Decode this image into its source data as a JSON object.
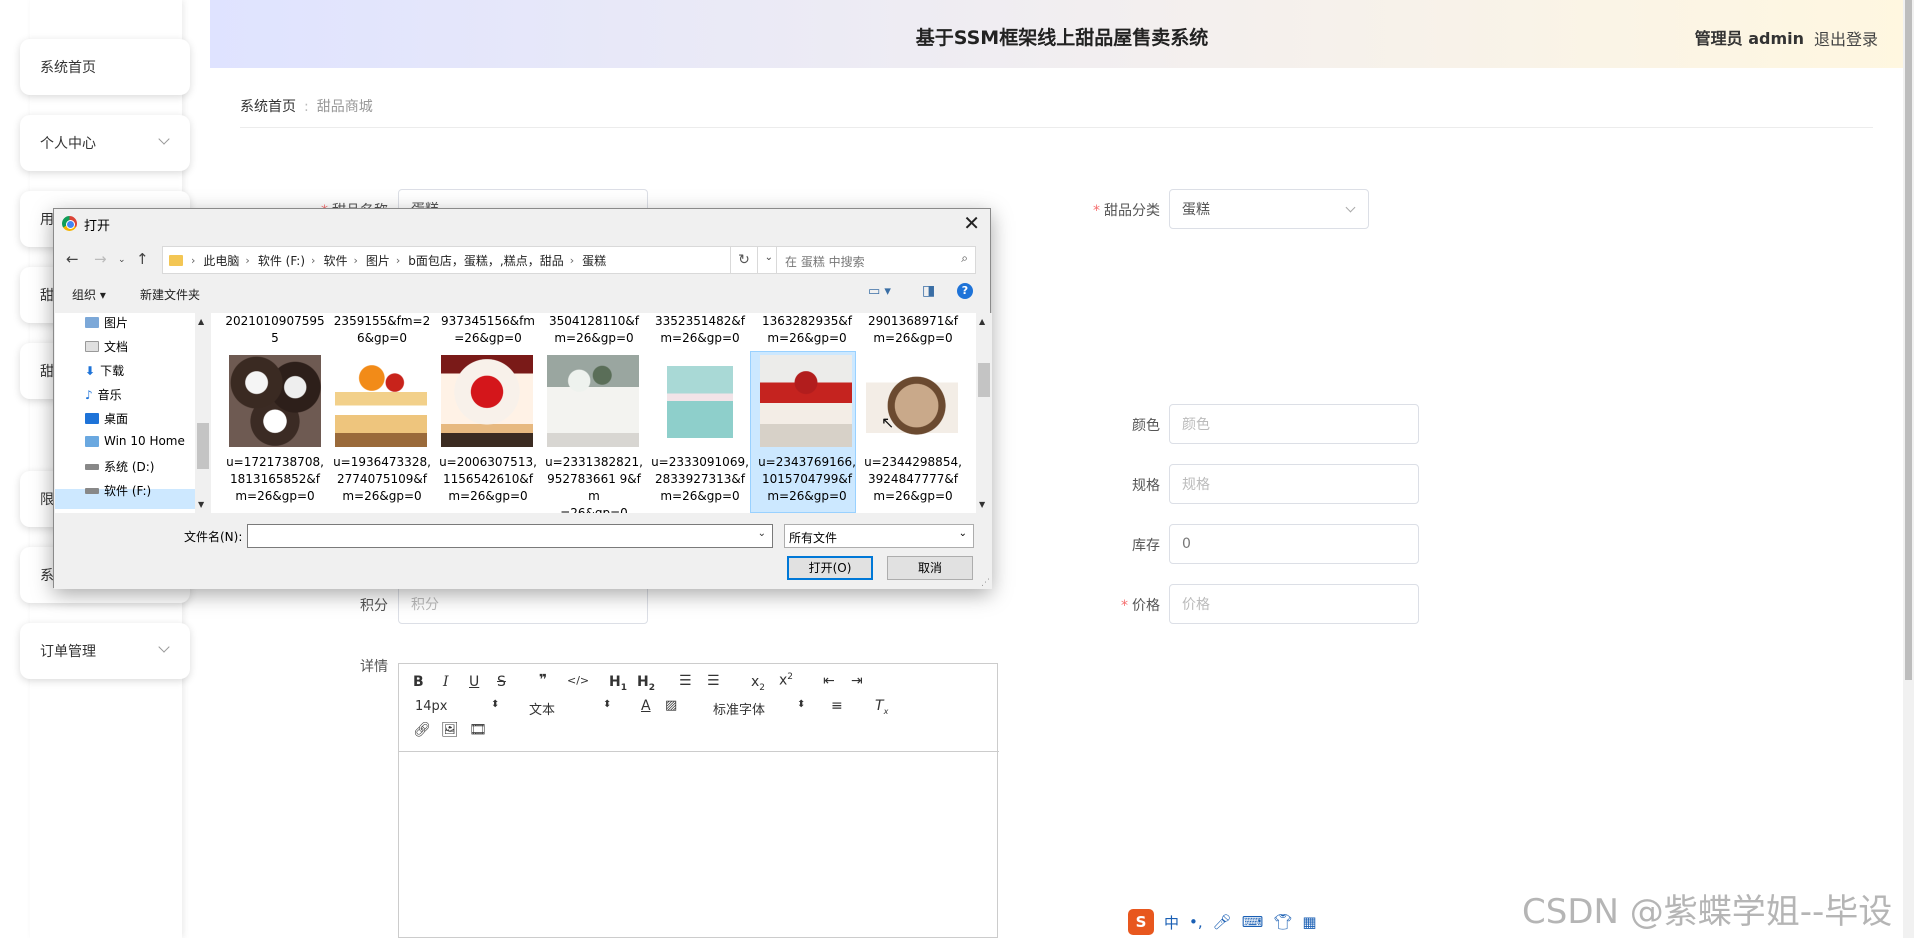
{
  "sidebar": {
    "items": [
      {
        "label": "系统首页",
        "expandable": false
      },
      {
        "label": "个人中心",
        "expandable": true
      },
      {
        "label": "用",
        "expandable": false
      },
      {
        "label": "甜",
        "expandable": false
      },
      {
        "label": "甜",
        "expandable": false
      },
      {
        "label": "限",
        "expandable": false
      },
      {
        "label": "系",
        "expandable": false
      },
      {
        "label": "订单管理",
        "expandable": true
      }
    ]
  },
  "header": {
    "title": "基于SSM框架线上甜品屋售卖系统",
    "user": "管理员 admin",
    "logout": "退出登录"
  },
  "breadcrumb": {
    "home": "系统首页",
    "current": "甜品商城"
  },
  "form": {
    "name_label": "甜品名称",
    "name_value": "蛋糕",
    "category_label": "甜品分类",
    "category_value": "蛋糕",
    "color_label": "颜色",
    "color_placeholder": "颜色",
    "spec_label": "规格",
    "spec_placeholder": "规格",
    "stock_label": "库存",
    "stock_value": "0",
    "points_label": "积分",
    "points_placeholder": "积分",
    "price_label": "价格",
    "price_placeholder": "价格",
    "detail_label": "详情"
  },
  "editor": {
    "font_size": "14px",
    "text_style": "文本",
    "font_family": "标准字体"
  },
  "dialog": {
    "title": "打开",
    "path": [
      "此电脑",
      "软件 (F:)",
      "软件",
      "图片",
      "b面包店，蛋糕，,糕点，甜品",
      "蛋糕"
    ],
    "search_placeholder": "在 蛋糕 中搜索",
    "organize": "组织",
    "new_folder": "新建文件夹",
    "tree": [
      "图片",
      "文档",
      "下载",
      "音乐",
      "桌面",
      "Win 10 Home",
      "系统 (D:)",
      "软件 (F:)"
    ],
    "top_row_names": [
      "2021010907595\n5",
      "2359155&fm=2\n6&gp=0",
      "937345156&fm\n=26&gp=0",
      "3504128110&f\nm=26&gp=0",
      "3352351482&f\nm=26&gp=0",
      "1363282935&f\nm=26&gp=0",
      "2901368971&f\nm=26&gp=0"
    ],
    "files": [
      {
        "name": "u=1721738708,\n1813165852&f\nm=26&gp=0",
        "thumb": "cupcakes",
        "selected": false
      },
      {
        "name": "u=1936473328,\n2774075109&f\nm=26&gp=0",
        "thumb": "fruit-sponge-cake",
        "selected": false
      },
      {
        "name": "u=2006307513,\n1156542610&f\nm=26&gp=0",
        "thumb": "strawberry-cake",
        "selected": false
      },
      {
        "name": "u=2331382821,\n952783661 9&fm\n=26&gp=0",
        "thumb": "white-flower-cake",
        "selected": false
      },
      {
        "name": "u=2333091069,\n2833927313&f\nm=26&gp=0",
        "thumb": "pastel-tier-cake",
        "selected": false
      },
      {
        "name": "u=2343769166,\n1015704799&f\nm=26&gp=0",
        "thumb": "red-box-cake",
        "selected": true
      },
      {
        "name": "u=2344298854,\n3924847777&f\nm=26&gp=0",
        "thumb": "chestnut-roll",
        "selected": false
      }
    ],
    "filename_label": "文件名(N):",
    "filename_value": "",
    "filetype": "所有文件",
    "open_button": "打开(O)",
    "cancel_button": "取消"
  },
  "ime": {
    "lang": "中"
  },
  "watermark": "CSDN @紫蝶学姐--毕设",
  "colors": {
    "required": "#f56c6c",
    "selection": "#cce8ff",
    "accent": "#0078d7"
  }
}
